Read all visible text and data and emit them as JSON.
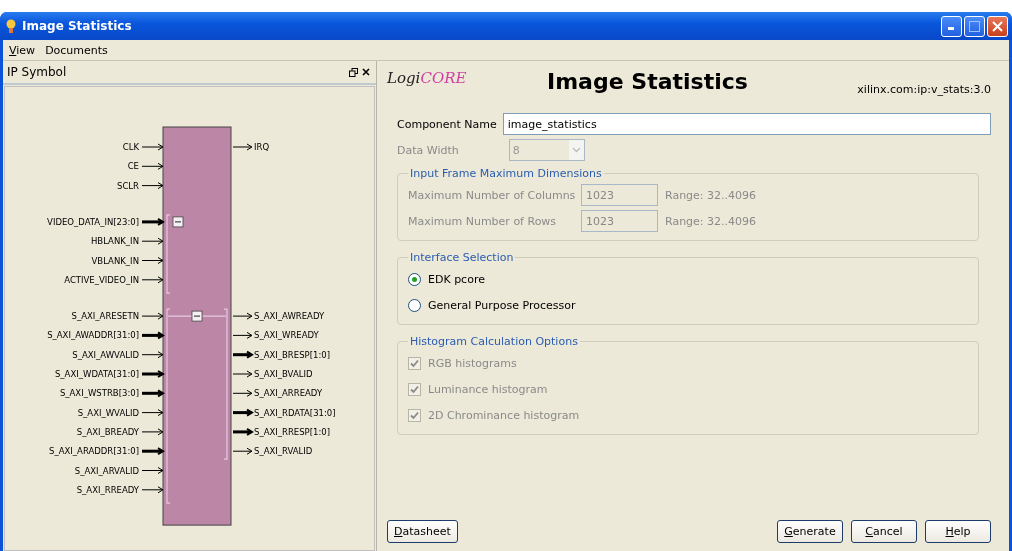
{
  "window": {
    "title": "Image Statistics"
  },
  "menu": [
    {
      "label": "View",
      "underline_first": true
    },
    {
      "label": "Documents",
      "underline_first": false
    }
  ],
  "symbol_panel": {
    "title": "IP Symbol",
    "sections": [
      {
        "left": [
          {
            "name": "CLK",
            "kind": "wire"
          },
          {
            "name": "CE",
            "kind": "wire"
          },
          {
            "name": "SCLR",
            "kind": "wire"
          }
        ],
        "right": [
          {
            "name": "IRQ",
            "kind": "wire"
          }
        ]
      },
      {
        "expanded": true,
        "left": [
          {
            "name": "VIDEO_DATA_IN[23:0]",
            "kind": "bus"
          },
          {
            "name": "HBLANK_IN",
            "kind": "wire"
          },
          {
            "name": "VBLANK_IN",
            "kind": "wire"
          },
          {
            "name": "ACTIVE_VIDEO_IN",
            "kind": "wire"
          }
        ]
      },
      {
        "expanded": true,
        "left": [
          {
            "name": "S_AXI_ARESETN",
            "kind": "wire"
          },
          {
            "name": "S_AXI_AWADDR[31:0]",
            "kind": "bus"
          },
          {
            "name": "S_AXI_AWVALID",
            "kind": "wire"
          },
          {
            "name": "S_AXI_WDATA[31:0]",
            "kind": "bus"
          },
          {
            "name": "S_AXI_WSTRB[3:0]",
            "kind": "bus"
          },
          {
            "name": "S_AXI_WVALID",
            "kind": "wire"
          },
          {
            "name": "S_AXI_BREADY",
            "kind": "wire"
          },
          {
            "name": "S_AXI_ARADDR[31:0]",
            "kind": "bus"
          },
          {
            "name": "S_AXI_ARVALID",
            "kind": "wire"
          },
          {
            "name": "S_AXI_RREADY",
            "kind": "wire"
          }
        ],
        "right": [
          {
            "name": "S_AXI_AWREADY",
            "kind": "wire"
          },
          {
            "name": "S_AXI_WREADY",
            "kind": "wire"
          },
          {
            "name": "S_AXI_BRESP[1:0]",
            "kind": "bus"
          },
          {
            "name": "S_AXI_BVALID",
            "kind": "wire"
          },
          {
            "name": "S_AXI_ARREADY",
            "kind": "wire"
          },
          {
            "name": "S_AXI_RDATA[31:0]",
            "kind": "bus"
          },
          {
            "name": "S_AXI_RRESP[1:0]",
            "kind": "bus"
          },
          {
            "name": "S_AXI_RVALID",
            "kind": "wire"
          }
        ]
      }
    ]
  },
  "header": {
    "logo": [
      "Logi",
      "CORE"
    ],
    "title": "Image Statistics",
    "vlnv": "xilinx.com:ip:v_stats:3.0"
  },
  "component_name": {
    "label": "Component Name",
    "value": "image_statistics"
  },
  "data_width": {
    "label": "Data Width",
    "value": "8",
    "disabled": true
  },
  "frame_group": {
    "title": "Input Frame Maximum Dimensions",
    "disabled": true,
    "rows": [
      {
        "label": "Maximum Number of Columns",
        "value": "1023",
        "range": "Range: 32..4096"
      },
      {
        "label": "Maximum Number of Rows",
        "value": "1023",
        "range": "Range: 32..4096"
      }
    ]
  },
  "interface_group": {
    "title": "Interface Selection",
    "options": [
      {
        "label": "EDK pcore",
        "selected": true
      },
      {
        "label": "General Purpose Processor",
        "selected": false
      }
    ]
  },
  "histogram_group": {
    "title": "Histogram Calculation Options",
    "options": [
      {
        "label": "RGB histograms",
        "checked": true,
        "disabled": true
      },
      {
        "label": "Luminance histogram",
        "checked": true,
        "disabled": true
      },
      {
        "label": "2D Chrominance histogram",
        "checked": true,
        "disabled": true
      }
    ]
  },
  "left_buttons": [
    {
      "label": "Datasheet"
    }
  ],
  "right_buttons": [
    {
      "label": "Generate"
    },
    {
      "label": "Cancel"
    },
    {
      "label": "Help"
    }
  ]
}
